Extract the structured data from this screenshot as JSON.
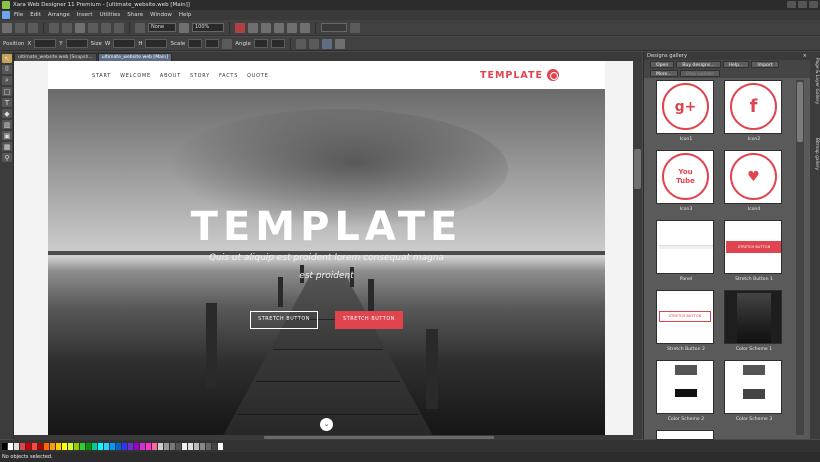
{
  "window": {
    "title": "Xara Web Designer 11 Premium - [ultimate_website.web [Main]]"
  },
  "menu": [
    "File",
    "Edit",
    "Arrange",
    "Insert",
    "Utilities",
    "Share",
    "Window",
    "Help"
  ],
  "toolbar": {
    "style_value": "None",
    "zoom_value": "100%"
  },
  "infobar": {
    "position_label": "Position",
    "size_label": "Size",
    "scale_label": "Scale",
    "angle_label": "Angle",
    "x_label": "X",
    "y_label": "Y",
    "w_label": "W",
    "h_label": "H"
  },
  "doc_tabs": [
    {
      "label": "ultimate_website.web [Snapsh..."
    },
    {
      "label": "ultimate_website.web [Main]"
    }
  ],
  "site": {
    "nav": [
      "START",
      "WELCOME",
      "ABOUT",
      "STORY",
      "FACTS",
      "QUOTE"
    ],
    "brand": "TEMPLATE",
    "hero_title": "TEMPLATE",
    "hero_subtitle": "Quis ut aliquip est proident lorem consequat magna  est proident",
    "button_outline": "STRETCH BUTTON",
    "button_filled": "STRETCH BUTTON",
    "accent": "#e0454f"
  },
  "gallery": {
    "title": "Designs gallery",
    "buttons": [
      "Open",
      "Buy designs...",
      "Help...",
      "Import",
      "More...",
      "Stop update"
    ],
    "items": [
      {
        "caption": "Icon1",
        "glyph": "g+"
      },
      {
        "caption": "Icon2",
        "glyph": "f"
      },
      {
        "caption": "Icon3",
        "glyph": "You Tube"
      },
      {
        "caption": "Icon4",
        "glyph": "♥"
      },
      {
        "caption": "Panel",
        "glyph": ""
      },
      {
        "caption": "Stretch Button 1",
        "glyph": "STRETCH BUTTON"
      },
      {
        "caption": "Stretch Button 2",
        "glyph": "STRETCH BUTTON"
      },
      {
        "caption": "Color Scheme 1",
        "glyph": ""
      },
      {
        "caption": "Color Scheme 2",
        "glyph": ""
      },
      {
        "caption": "Color Scheme 3",
        "glyph": ""
      }
    ]
  },
  "side_tabs": [
    "Page & Layer Gallery",
    "Bitmap gallery"
  ],
  "status": {
    "text": "No objects selected."
  },
  "palette": [
    "#000000",
    "#ffffff",
    "#e0e0e0",
    "#e0454f",
    "#cc0000",
    "#ff4444",
    "#aa0000",
    "#ff6600",
    "#ff9900",
    "#ffcc00",
    "#ffff00",
    "#ccff33",
    "#99cc00",
    "#33cc33",
    "#009900",
    "#00cc99",
    "#00ffff",
    "#33ccff",
    "#0099ff",
    "#0066cc",
    "#3333ff",
    "#6633cc",
    "#9900cc",
    "#cc33cc",
    "#ff33cc",
    "#ff6699",
    "#cccccc",
    "#999999",
    "#777777",
    "#555555",
    "#eeeeee",
    "#dddddd",
    "#bbbbbb",
    "#888888",
    "#666666",
    "#444444",
    "#ffffff"
  ]
}
